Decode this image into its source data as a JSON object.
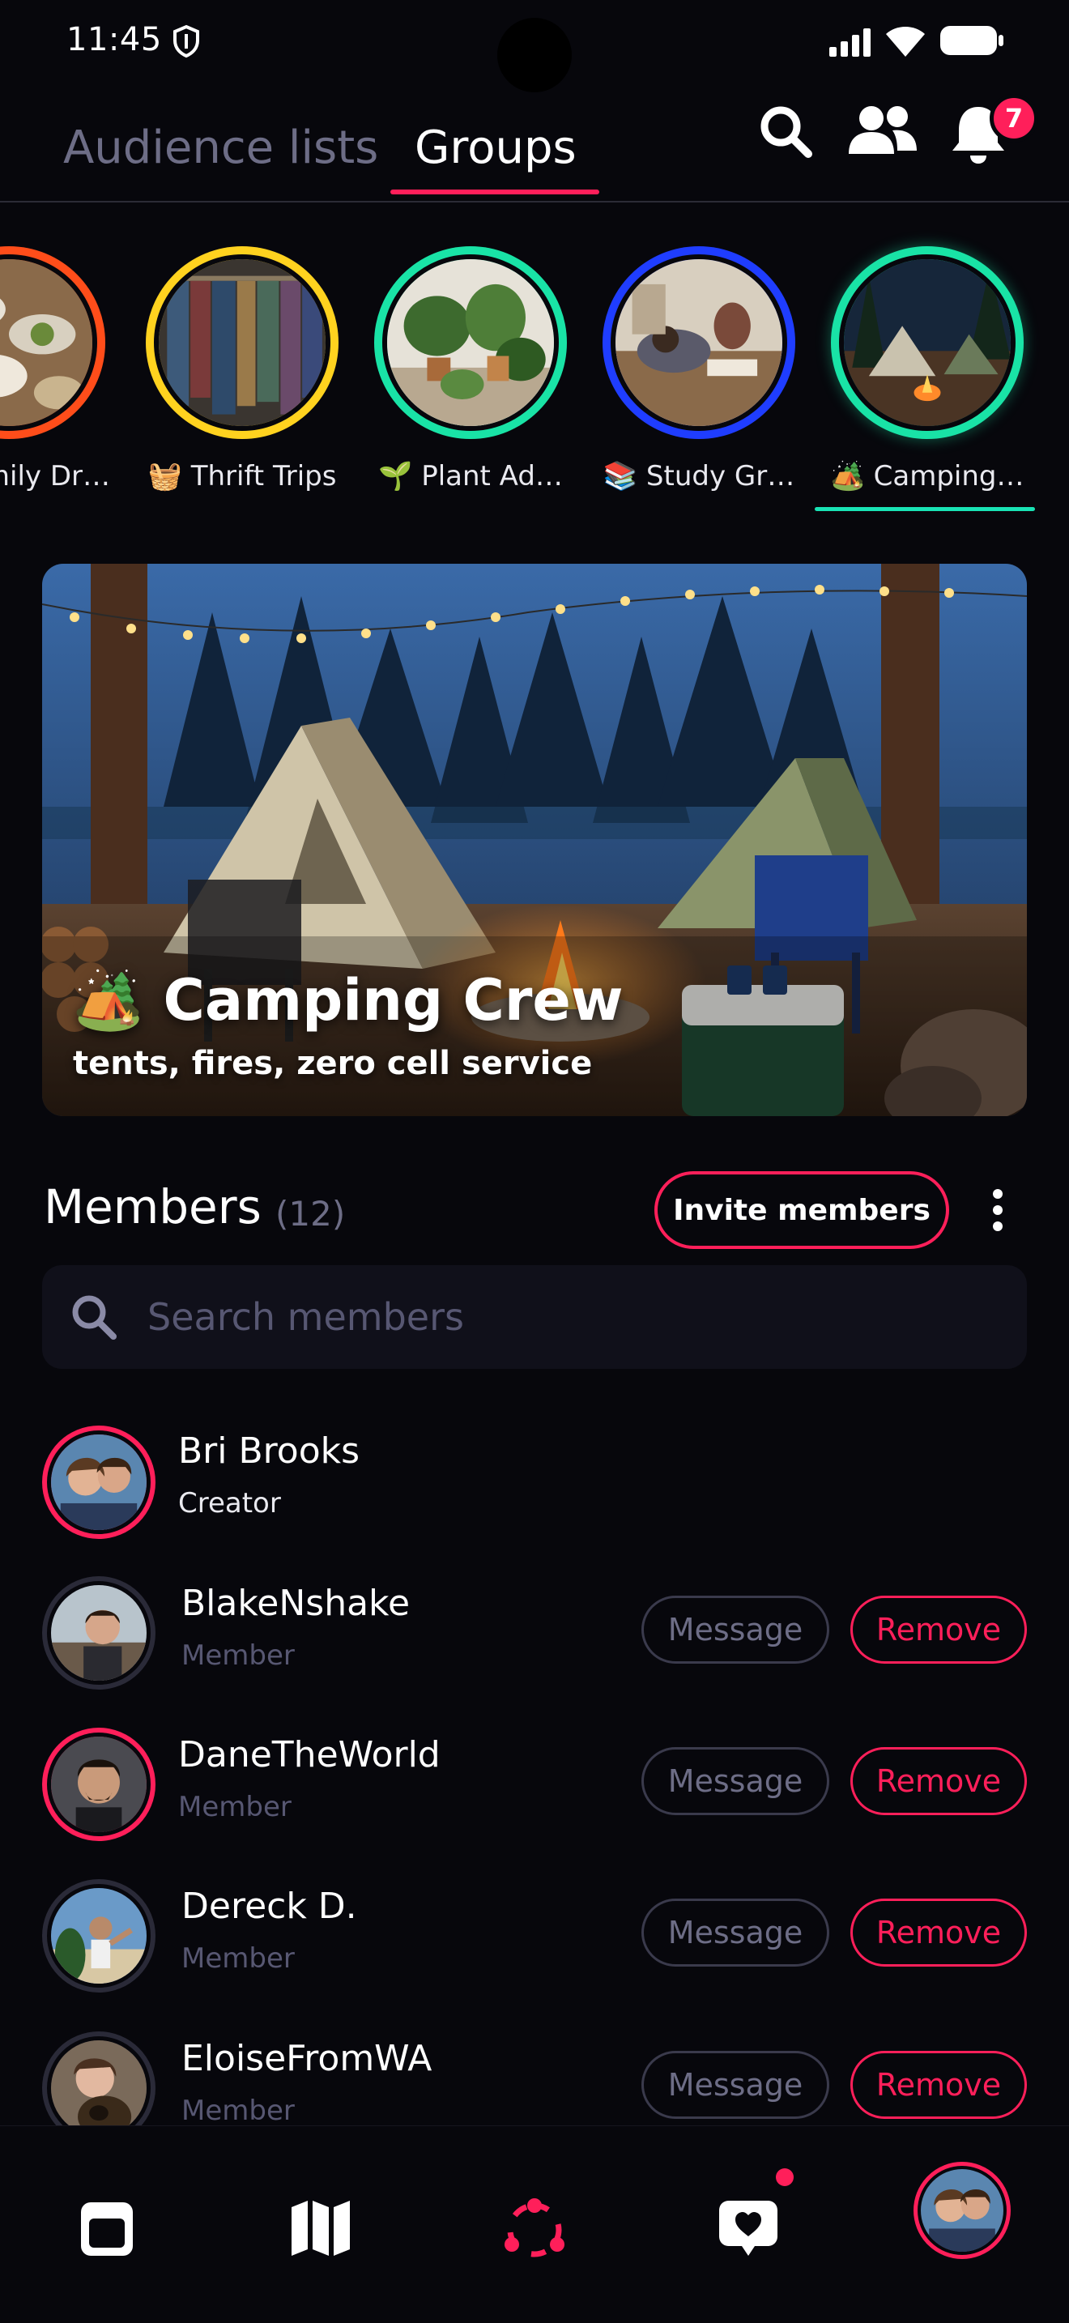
{
  "status_bar": {
    "time": "11:45"
  },
  "header": {
    "tabs": [
      {
        "label": "Audience lists",
        "active": false
      },
      {
        "label": "Groups",
        "active": true
      }
    ],
    "notification_count": "7"
  },
  "stories": [
    {
      "label": "mily Dr…",
      "ring_color": "#ff4d1a"
    },
    {
      "label": "🧺 Thrift Trips",
      "ring_color": "#ffd21f"
    },
    {
      "label": "🌱 Plant Ad…",
      "ring_color": "#19e3a6"
    },
    {
      "label": "📚 Study Gr…",
      "ring_color": "#1f3dff"
    },
    {
      "label": "🏕️ Camping…",
      "ring_color": "#19e3a6",
      "active": true
    }
  ],
  "group": {
    "title": "🏕️ Camping Crew",
    "subtitle": "tents, fires, zero cell service"
  },
  "members_section": {
    "title": "Members",
    "count": "(12)",
    "invite_label": "Invite members",
    "search_placeholder": "Search members"
  },
  "members": [
    {
      "name": "Bri Brooks",
      "role": "Creator",
      "ring": "#ff1f5a",
      "is_creator": true
    },
    {
      "name": "BlakeNshake",
      "role": "Member",
      "ring": "#2a2a38",
      "message": "Message",
      "remove": "Remove"
    },
    {
      "name": "DaneTheWorld",
      "role": "Member",
      "ring": "#ff1f5a",
      "message": "Message",
      "remove": "Remove"
    },
    {
      "name": "Dereck D.",
      "role": "Member",
      "ring": "#2a2a38",
      "message": "Message",
      "remove": "Remove"
    },
    {
      "name": "EloiseFromWA",
      "role": "Member",
      "ring": "#2a2a38",
      "message": "Message",
      "remove": "Remove"
    }
  ],
  "bottom_nav": [
    {
      "icon": "calendar-icon"
    },
    {
      "icon": "map-icon"
    },
    {
      "icon": "groups-icon",
      "active": true
    },
    {
      "icon": "heart-message-icon",
      "has_dot": true
    },
    {
      "icon": "profile-avatar"
    }
  ],
  "colors": {
    "accent": "#ff1f5a",
    "active_story": "#19e3b5",
    "muted_text": "#6d6d86",
    "background": "#07070c"
  }
}
